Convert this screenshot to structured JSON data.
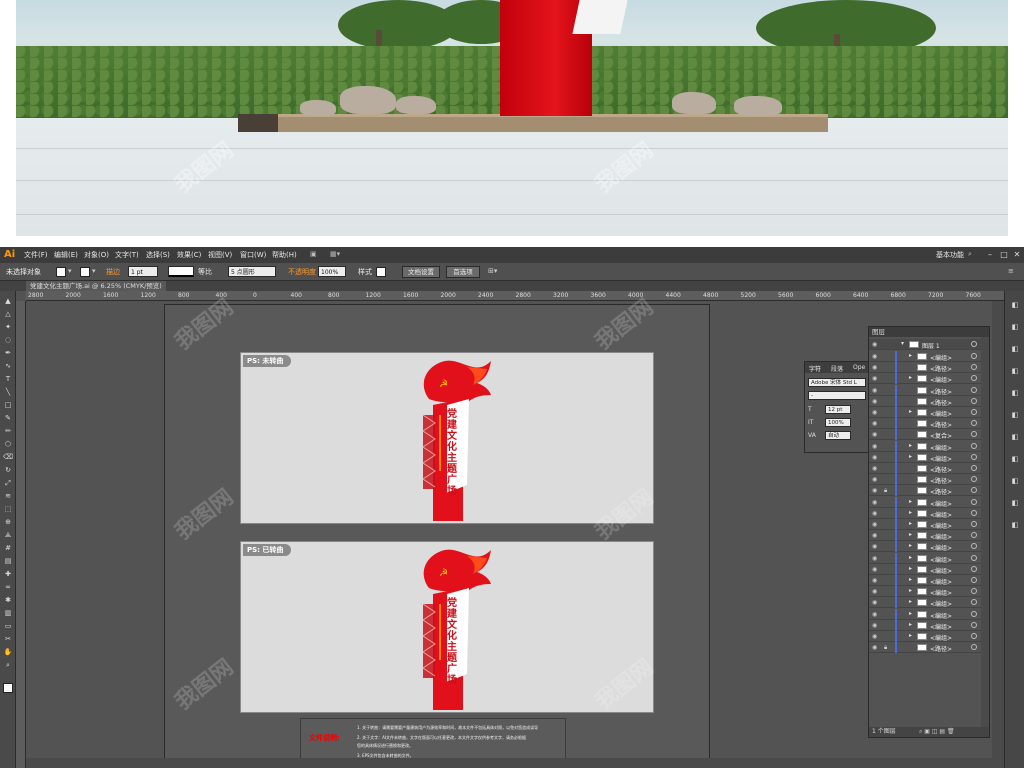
{
  "menubar": {
    "app_logo": "Ai",
    "items": [
      "文件(F)",
      "编辑(E)",
      "对象(O)",
      "文字(T)",
      "选择(S)",
      "效果(C)",
      "视图(V)",
      "窗口(W)",
      "帮助(H)"
    ],
    "workspace": "基本功能"
  },
  "control_bar": {
    "selection": "未选择对象",
    "stroke_label": "描边",
    "stroke_weight": "1 pt",
    "brush_label": "等比",
    "point_label": "5 点圆形",
    "opacity_label": "不透明度",
    "opacity_value": "100%",
    "style_label": "样式",
    "doc_setup": "文档设置",
    "preferences": "首选项"
  },
  "document_tab": {
    "title": "党建文化主题广场.ai @ 6.25% (CMYK/预览)"
  },
  "ruler": {
    "ticks": [
      "2800",
      "2000",
      "1600",
      "1200",
      "800",
      "400",
      "0",
      "400",
      "800",
      "1200",
      "1600",
      "2000",
      "2400",
      "2800",
      "3200",
      "3600",
      "4000",
      "4400",
      "4800",
      "5200",
      "5600",
      "6000",
      "6400",
      "6800",
      "7200",
      "7600"
    ]
  },
  "artboards": [
    {
      "label": "PS: 未转曲",
      "title": "党建文化主题广场"
    },
    {
      "label": "PS: 已转曲",
      "title": "党建文化主题广场"
    }
  ],
  "notes": {
    "title": "文件说明:",
    "lines": [
      "1. 关于转曲：请需要需要产量建筑用户为源效率和时间，故本文件不包括具体对照，以免对您造成误导",
      "2. 关于文字：AI文件未转曲，文字在版面可以任意更改，本文件文字仅供参考文字，请务必根据",
      "   您的具体情况进行替换和更改。",
      "3. EPS文件包含未转曲的文件。"
    ]
  },
  "character_panel": {
    "tabs": [
      "字符",
      "段落",
      "Ope"
    ],
    "font": "Adobe 宋体 Std L",
    "style": "-",
    "size": "12 pt",
    "scale": "100%",
    "tracking": "自动"
  },
  "layers_panel": {
    "title": "图层",
    "layer": "图层 1",
    "rows": [
      "<编组>",
      "<路径>",
      "<编组>",
      "<路径>",
      "<路径>",
      "<编组>",
      "<路径>",
      "<复合>",
      "<编组>",
      "<编组>",
      "<路径>",
      "<路径>",
      "<路径>",
      "<编组>",
      "<编组>",
      "<编组>",
      "<编组>",
      "<编组>",
      "<编组>",
      "<编组>",
      "<编组>",
      "<编组>",
      "<编组>",
      "<编组>",
      "<编组>",
      "<编组>",
      "<路径>"
    ],
    "footer": "1 个图层"
  },
  "watermark": "我图网",
  "colors": {
    "party_red": "#e2101a",
    "accent_orange": "#ff9a00"
  }
}
